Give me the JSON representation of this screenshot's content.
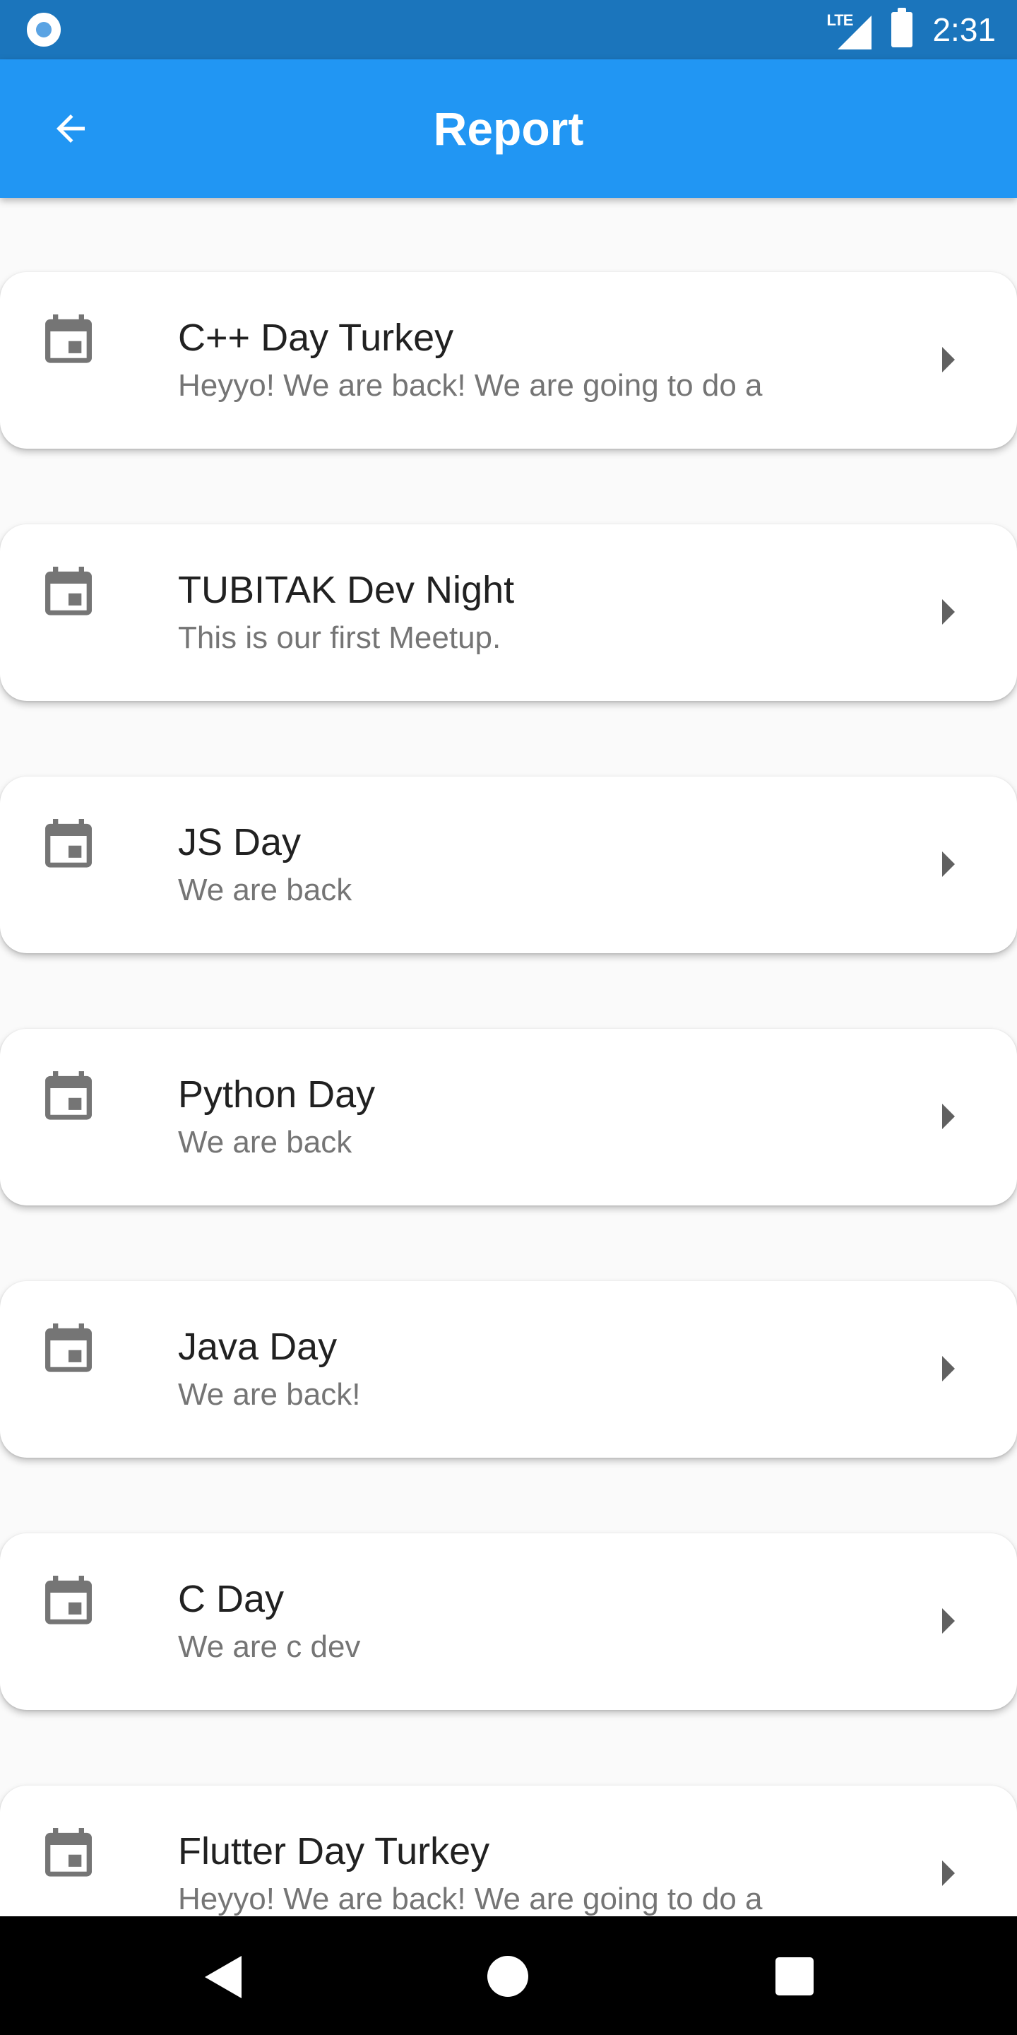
{
  "status_bar": {
    "network_label": "LTE",
    "time": "2:31",
    "icons": [
      "radio-button-icon",
      "signal-icon",
      "battery-icon"
    ]
  },
  "app_bar": {
    "title": "Report",
    "back_icon": "arrow-back-icon",
    "background_color": "#2196f3"
  },
  "events": [
    {
      "title": "C++ Day Turkey",
      "subtitle": "Heyyo! We are back! We are going to do a",
      "icon": "calendar-icon"
    },
    {
      "title": "TUBITAK Dev Night",
      "subtitle": "This is our first Meetup.",
      "icon": "calendar-icon"
    },
    {
      "title": "JS Day",
      "subtitle": "We are back",
      "icon": "calendar-icon"
    },
    {
      "title": "Python Day",
      "subtitle": "We are back",
      "icon": "calendar-icon"
    },
    {
      "title": "Java Day",
      "subtitle": "We are back!",
      "icon": "calendar-icon"
    },
    {
      "title": "C Day",
      "subtitle": "We are c dev",
      "icon": "calendar-icon"
    },
    {
      "title": "Flutter Day Turkey",
      "subtitle": "Heyyo! We are back! We are going to do a",
      "icon": "calendar-icon"
    }
  ],
  "nav_bar": {
    "icons": [
      "nav-back-icon",
      "nav-home-icon",
      "nav-recents-icon"
    ]
  }
}
